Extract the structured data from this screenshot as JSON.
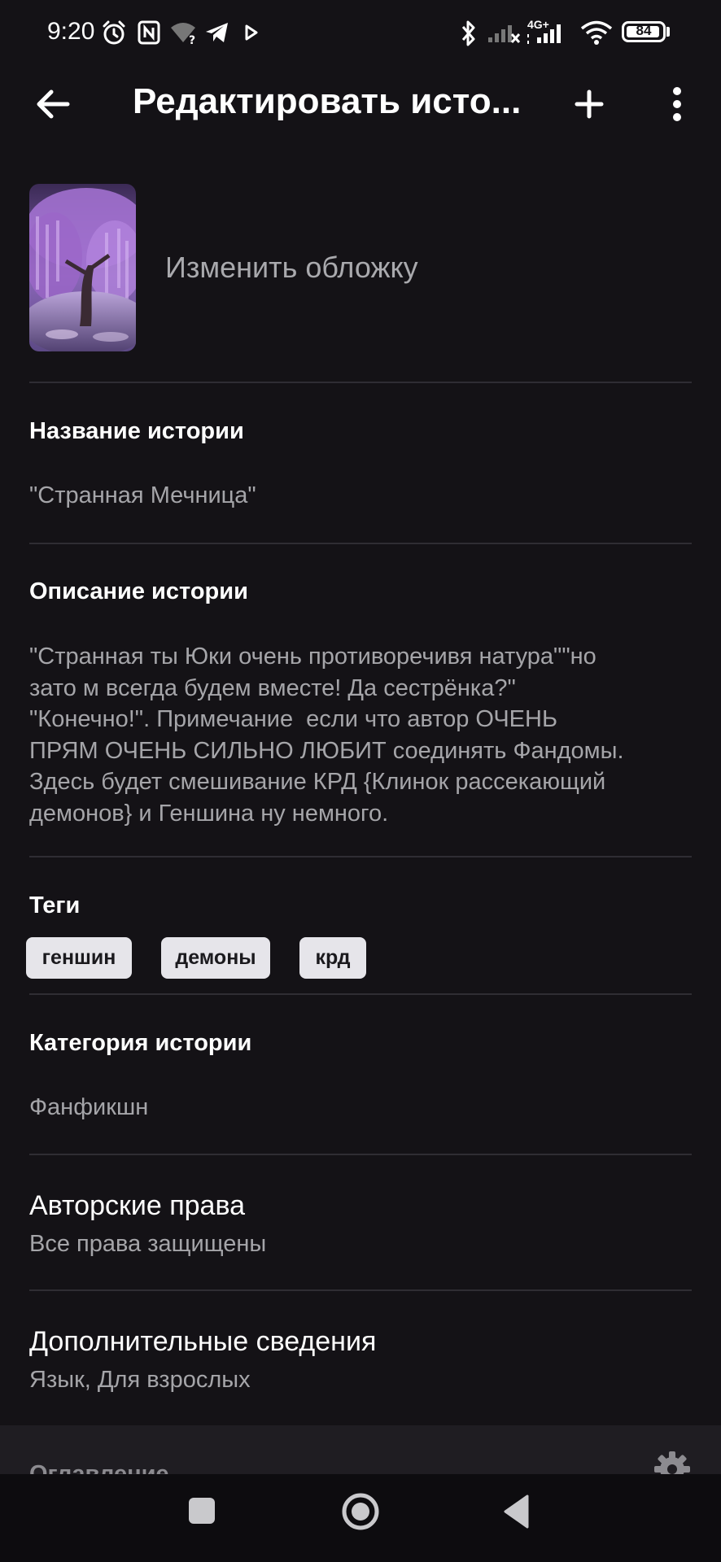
{
  "status_bar": {
    "time": "9:20",
    "network": "4G+",
    "battery": "84"
  },
  "app_bar": {
    "title": "Редактировать исто..."
  },
  "cover": {
    "label": "Изменить обложку"
  },
  "story_title": {
    "label": "Название истории",
    "value": "\"Странная Мечница\""
  },
  "story_description": {
    "label": "Описание истории",
    "value": "\"Странная ты Юки очень противоречивя натура\"\"но\nзато м всегда будем вместе! Да сестрёнка?\"\n\"Конечно!\". Примечание  если что автор ОЧЕНЬ\nПРЯМ ОЧЕНЬ СИЛЬНО ЛЮБИТ соединять Фандомы.\nЗдесь будет смешивание КРД {Клинок рассекающий\nдемонов} и Геншина ну немного."
  },
  "tags": {
    "label": "Теги",
    "items": [
      "геншин",
      "демоны",
      "крд"
    ]
  },
  "category": {
    "label": "Категория истории",
    "value": "Фанфикшн"
  },
  "copyright": {
    "label": "Авторские права",
    "value": "Все права защищены"
  },
  "extra_info": {
    "label": "Дополнительные сведения",
    "value": "Язык, Для взрослых"
  },
  "toc": {
    "label": "Оглавление"
  },
  "icons": {
    "back": "arrow-left-icon",
    "add": "plus-icon",
    "more": "more-vertical-icon",
    "settings": "gear-icon"
  }
}
